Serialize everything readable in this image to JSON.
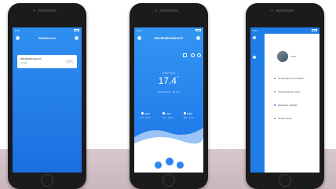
{
  "status_time": "9:41",
  "phone1": {
    "title": "WiziSwerve",
    "device_id": "0BC8E3BDAEE4CF",
    "device_status": "● Online",
    "device_action": "ON"
  },
  "phone2": {
    "title": "0BC8E3BDAEE4CF",
    "indoor_label": "Indoor Temp",
    "indoor_value": "17.4",
    "indoor_unit": "°C",
    "target_label": "Target Temp : 18.0°C",
    "forecast": [
      {
        "day": "MON",
        "range": "8°C ~ 16°C"
      },
      {
        "day": "TUE",
        "range": "7°C ~ 15°C"
      },
      {
        "day": "WED",
        "range": "9°C ~ 17°C"
      }
    ]
  },
  "phone3": {
    "user_label": "User",
    "menu": [
      {
        "label": "Temperature unit switchi..."
      },
      {
        "label": "Change device name"
      },
      {
        "label": "parameter settings"
      },
      {
        "label": "Device share"
      }
    ]
  }
}
